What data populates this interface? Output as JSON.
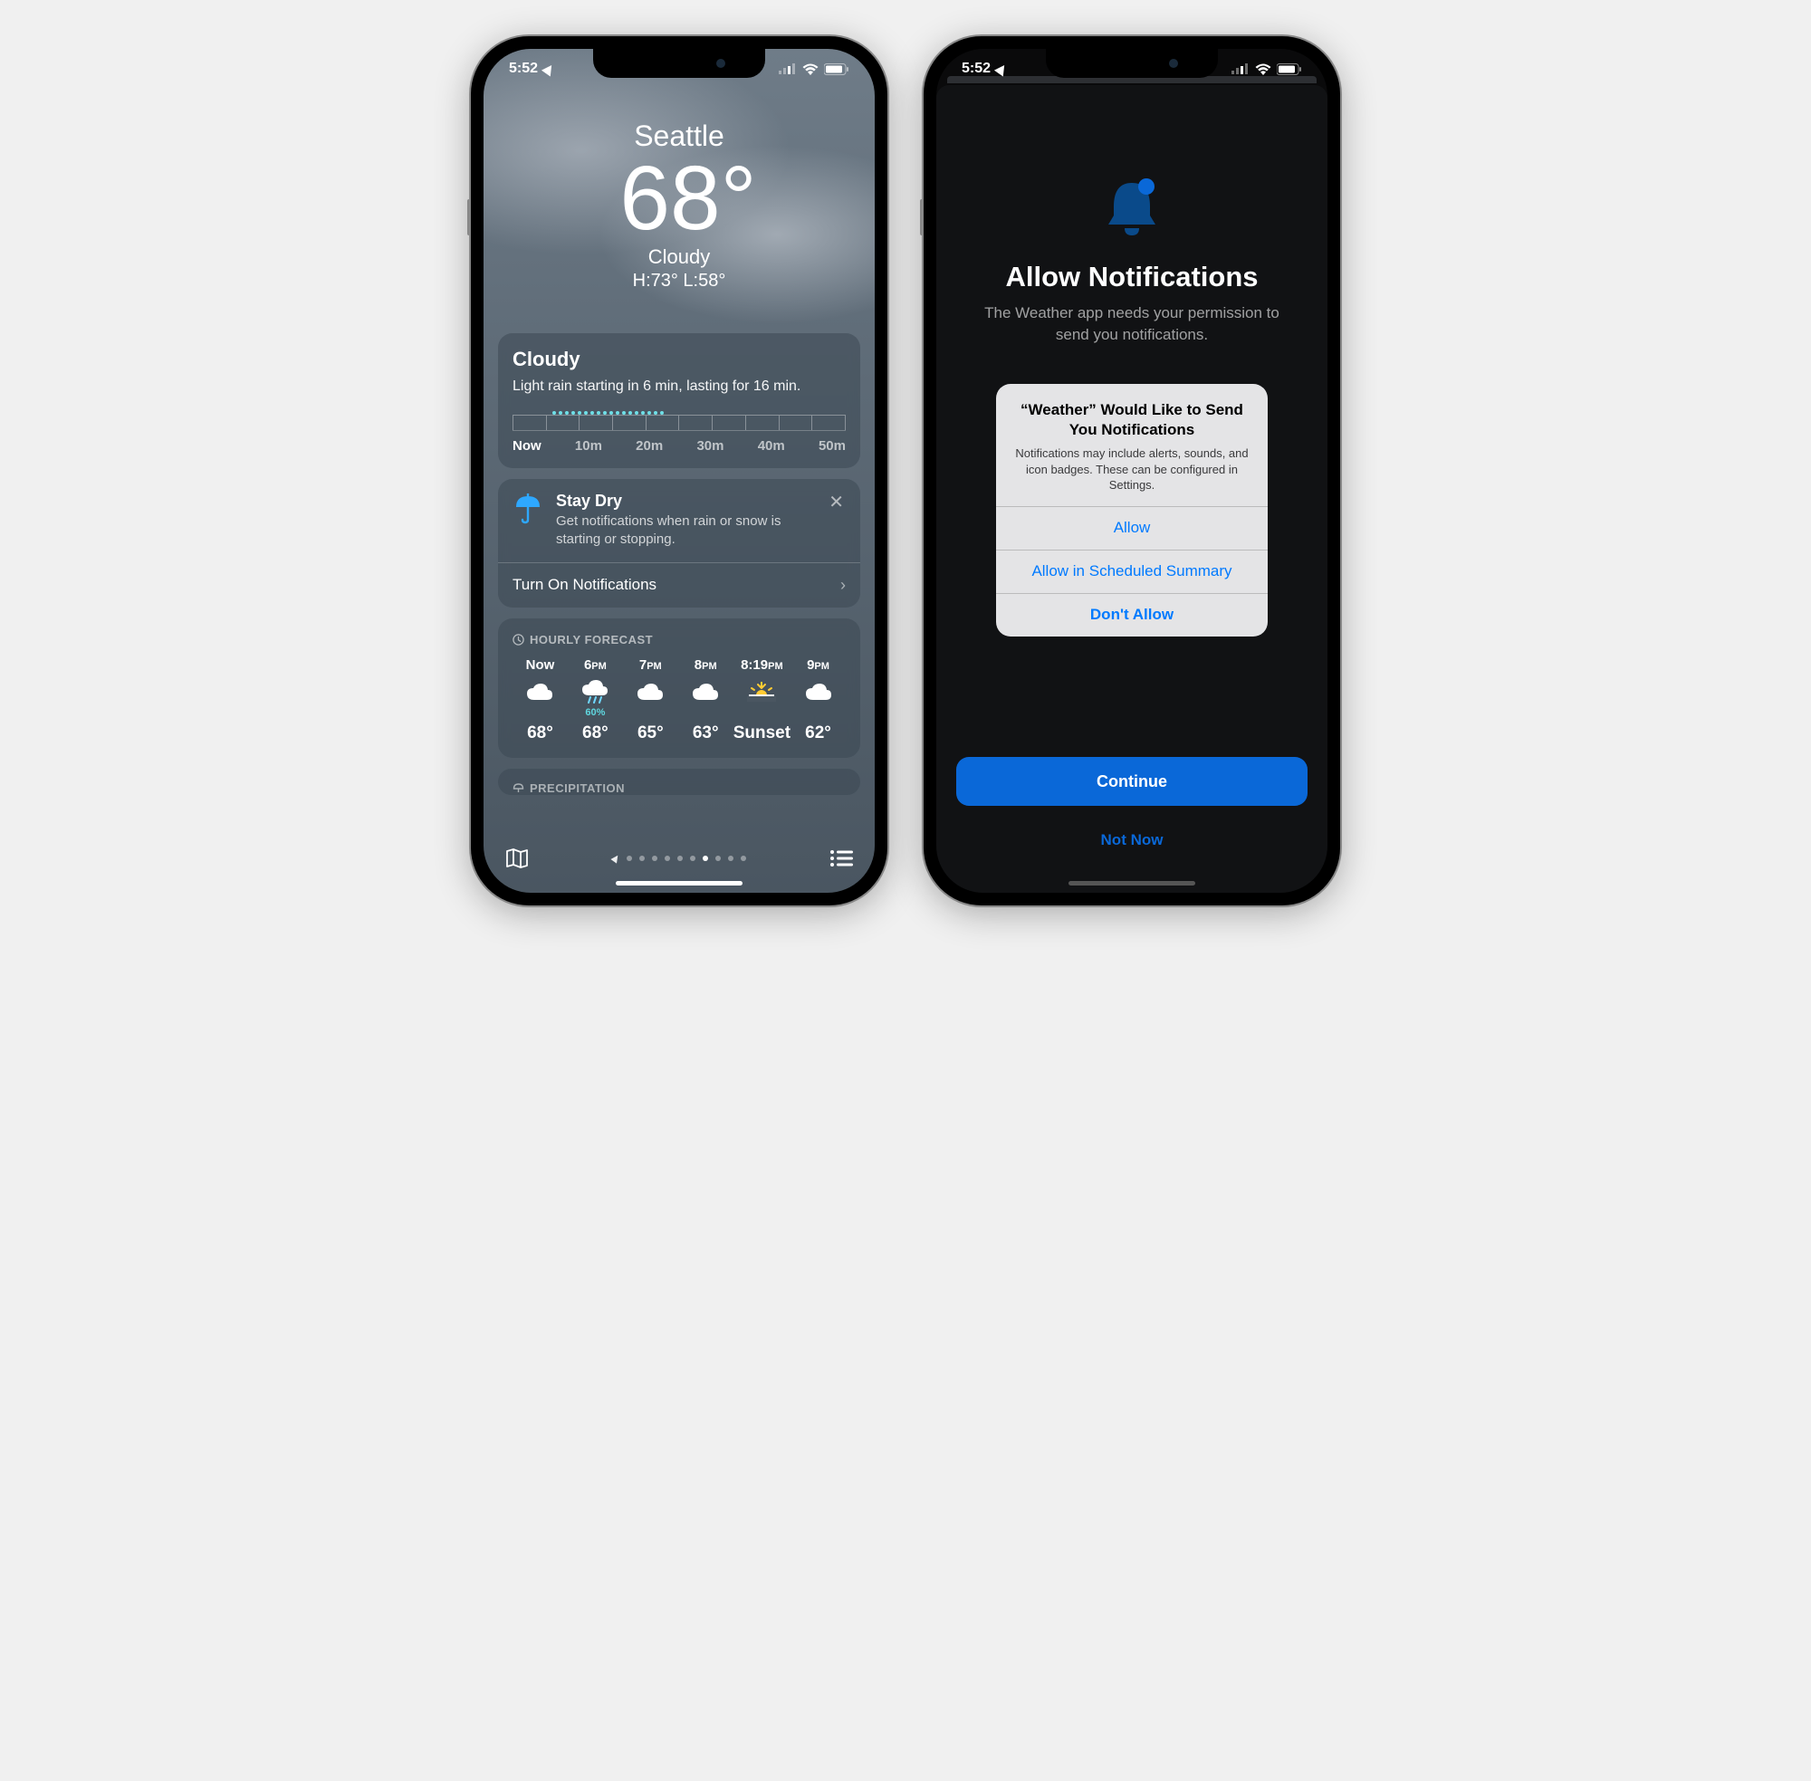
{
  "status": {
    "time": "5:52"
  },
  "weather": {
    "city": "Seattle",
    "temp": "68°",
    "condition": "Cloudy",
    "hi_lo": "H:73°  L:58°",
    "rain_card": {
      "title": "Cloudy",
      "desc": "Light rain starting in 6 min, lasting for 16 min.",
      "labels": [
        "Now",
        "10m",
        "20m",
        "30m",
        "40m",
        "50m"
      ]
    },
    "stay": {
      "title": "Stay Dry",
      "desc": "Get notifications when rain or snow is starting or stopping.",
      "cta": "Turn On Notifications"
    },
    "hourly_head": "HOURLY FORECAST",
    "hourly": [
      {
        "time": "Now",
        "icon": "cloud",
        "pct": "",
        "temp": "68°"
      },
      {
        "time": "6PM",
        "icon": "cloudrain",
        "pct": "60%",
        "temp": "68°"
      },
      {
        "time": "7PM",
        "icon": "cloud",
        "pct": "",
        "temp": "65°"
      },
      {
        "time": "8PM",
        "icon": "cloud",
        "pct": "",
        "temp": "63°"
      },
      {
        "time": "8:19PM",
        "icon": "sunset",
        "pct": "",
        "temp": "Sunset"
      },
      {
        "time": "9PM",
        "icon": "cloud",
        "pct": "",
        "temp": "62°"
      }
    ],
    "precip_head": "PRECIPITATION"
  },
  "notif": {
    "title": "Allow Notifications",
    "sub": "The Weather app needs your permission to send you notifications.",
    "continue": "Continue",
    "not_now": "Not Now"
  },
  "alert": {
    "title": "“Weather” Would Like to Send You Notifications",
    "msg": "Notifications may include alerts, sounds, and icon badges. These can be configured in Settings.",
    "allow": "Allow",
    "summary": "Allow in Scheduled Summary",
    "dont": "Don't Allow"
  }
}
